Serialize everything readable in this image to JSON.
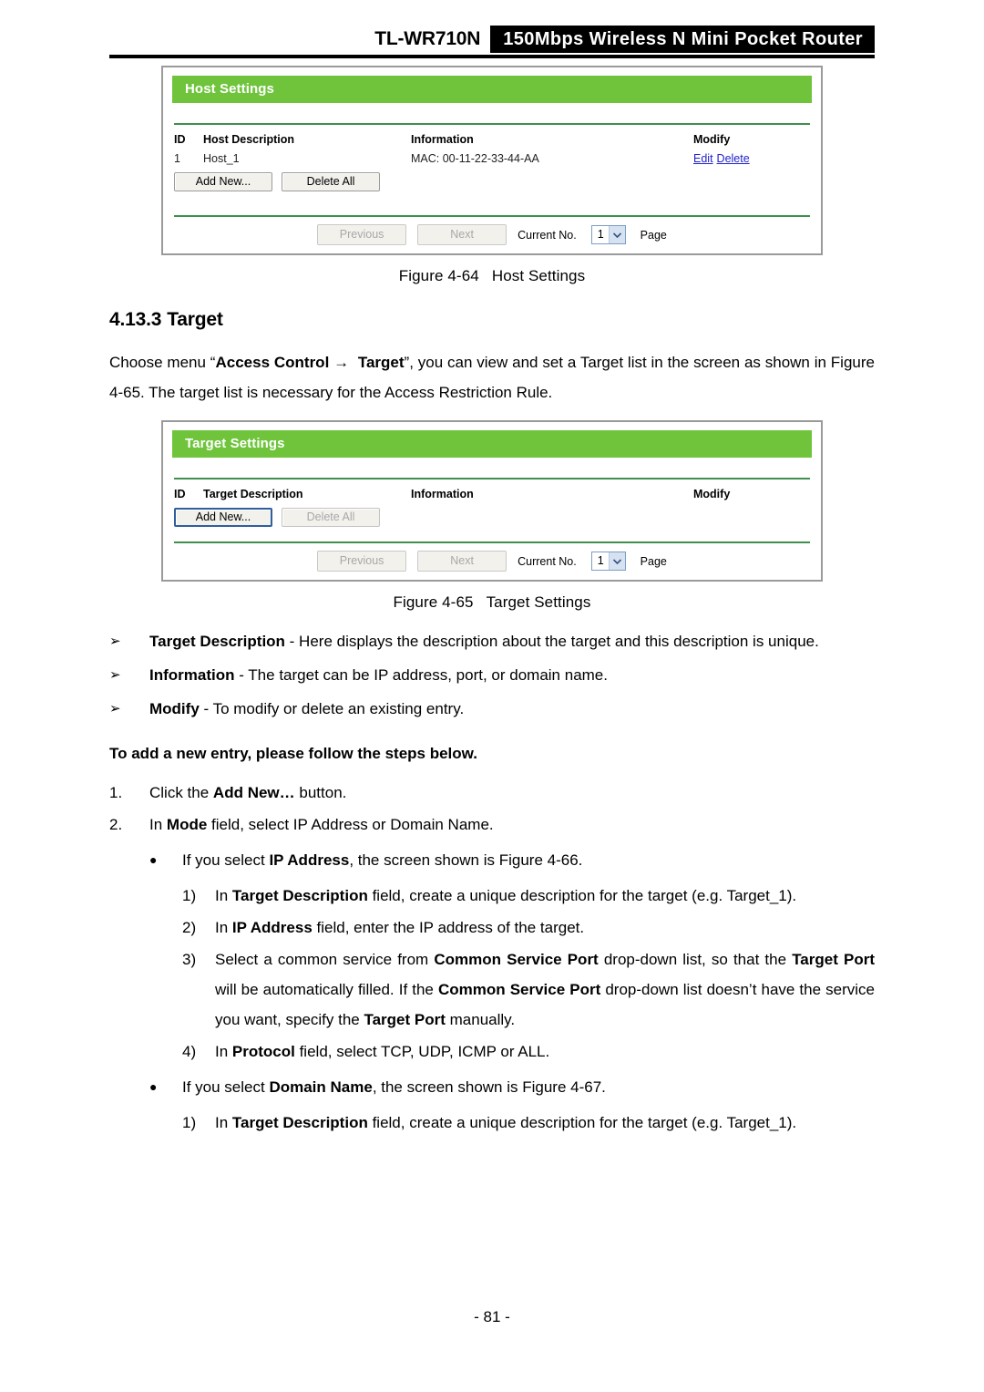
{
  "header": {
    "model": "TL-WR710N",
    "product": "150Mbps Wireless N Mini Pocket Router"
  },
  "figure_host": {
    "title": "Host Settings",
    "columns": {
      "id": "ID",
      "description": "Host Description",
      "information": "Information",
      "modify": "Modify"
    },
    "rows": [
      {
        "id": "1",
        "description": "Host_1",
        "information": "MAC: 00-11-22-33-44-AA",
        "edit": "Edit",
        "delete": "Delete"
      }
    ],
    "buttons": {
      "add_new": "Add New...",
      "delete_all": "Delete All"
    },
    "pager": {
      "previous": "Previous",
      "next": "Next",
      "current_label": "Current No.",
      "current_value": "1",
      "page_label": "Page"
    },
    "caption_number": "Figure 4-64",
    "caption_text": "Host Settings"
  },
  "section": {
    "number": "4.13.3",
    "title": "Target",
    "intro_part1": "Choose menu “",
    "intro_bold1": "Access Control",
    "intro_arrow": "→",
    "intro_bold2": "Target",
    "intro_part2": "”, you can view and set a Target list in the screen as shown in Figure 4-65. The target list is necessary for the Access Restriction Rule."
  },
  "figure_target": {
    "title": "Target Settings",
    "columns": {
      "id": "ID",
      "description": "Target Description",
      "information": "Information",
      "modify": "Modify"
    },
    "rows": [],
    "buttons": {
      "add_new": "Add New...",
      "delete_all": "Delete All"
    },
    "pager": {
      "previous": "Previous",
      "next": "Next",
      "current_label": "Current No.",
      "current_value": "1",
      "page_label": "Page"
    },
    "caption_number": "Figure 4-65",
    "caption_text": "Target Settings"
  },
  "definitions": [
    {
      "marker": "➢",
      "term": "Target Description",
      "rest": " - Here displays the description about the target and this description is unique."
    },
    {
      "marker": "➢",
      "term": "Information",
      "rest": " - The target can be IP address, port, or domain name."
    },
    {
      "marker": "➢",
      "term": "Modify",
      "rest": " - To modify or delete an existing entry."
    }
  ],
  "steps_intro": "To add a new entry, please follow the steps below.",
  "steps": [
    {
      "marker": "1.",
      "pre": "Click the ",
      "bold": "Add New…",
      "post": " button."
    },
    {
      "marker": "2.",
      "pre": "In ",
      "bold": "Mode",
      "post": " field, select IP Address or Domain Name."
    }
  ],
  "ip_branch": {
    "marker": "●",
    "pre": "If you select ",
    "bold": "IP Address",
    "post": ", the screen shown is Figure 4-66.",
    "substeps": [
      {
        "marker": "1)",
        "segments": [
          {
            "text": "In ",
            "bold": false
          },
          {
            "text": "Target Description",
            "bold": true
          },
          {
            "text": " field, create a unique description for the target (e.g. Target_1).",
            "bold": false
          }
        ]
      },
      {
        "marker": "2)",
        "segments": [
          {
            "text": "In ",
            "bold": false
          },
          {
            "text": "IP Address",
            "bold": true
          },
          {
            "text": " field, enter the IP address of the target.",
            "bold": false
          }
        ]
      },
      {
        "marker": "3)",
        "segments": [
          {
            "text": "Select a common service from ",
            "bold": false
          },
          {
            "text": "Common Service Port",
            "bold": true
          },
          {
            "text": " drop-down list, so that the ",
            "bold": false
          },
          {
            "text": "Target Port",
            "bold": true
          },
          {
            "text": " will be automatically filled. If the ",
            "bold": false
          },
          {
            "text": "Common Service Port",
            "bold": true
          },
          {
            "text": " drop-down list doesn’t have the service you want, specify the ",
            "bold": false
          },
          {
            "text": "Target Port",
            "bold": true
          },
          {
            "text": " manually.",
            "bold": false
          }
        ]
      },
      {
        "marker": "4)",
        "segments": [
          {
            "text": "In ",
            "bold": false
          },
          {
            "text": "Protocol",
            "bold": true
          },
          {
            "text": " field, select TCP, UDP, ICMP or ALL.",
            "bold": false
          }
        ]
      }
    ]
  },
  "domain_branch": {
    "marker": "●",
    "pre": "If you select ",
    "bold": "Domain Name",
    "post": ", the screen shown is Figure 4-67.",
    "substeps": [
      {
        "marker": "1)",
        "segments": [
          {
            "text": "In ",
            "bold": false
          },
          {
            "text": "Target Description",
            "bold": true
          },
          {
            "text": " field, create a unique description for the target (e.g. Target_1).",
            "bold": false
          }
        ]
      }
    ]
  },
  "footer": {
    "page_number": "- 81 -"
  },
  "colors": {
    "ui_green": "#6fc43c",
    "divider_green": "#3f8f4f",
    "link_blue": "#2222cc",
    "banner_black": "#000000"
  }
}
